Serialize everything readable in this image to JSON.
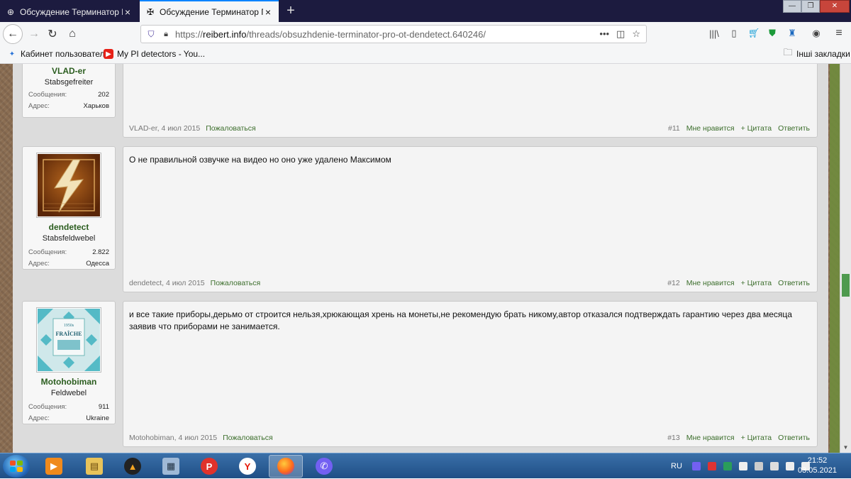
{
  "browser": {
    "tabs": [
      {
        "title": "Обсуждение Терминатор ПРО",
        "active": false
      },
      {
        "title": "Обсуждение Терминатор ПРО",
        "active": true
      }
    ],
    "url_prefix": "https://",
    "url_domain": "reibert.info",
    "url_path": "/threads/obsuzhdenie-terminator-pro-ot-dendetect.640246/",
    "bookmarks": [
      {
        "label": "Кабинет пользователя"
      },
      {
        "label": "My PI detectors - You..."
      }
    ],
    "other_bookmarks": "Інші закладки"
  },
  "posts": [
    {
      "username": "VLAD-er",
      "rank": "Stabsgefreiter",
      "messages_label": "Сообщения:",
      "messages": "202",
      "address_label": "Адрес:",
      "address": "Харьков",
      "text": "",
      "meta": "VLAD-er, 4 июл 2015",
      "report": "Пожаловаться",
      "number": "#11",
      "like": "Мне нравится",
      "quote": "+ Цитата",
      "reply": "Ответить"
    },
    {
      "username": "dendetect",
      "rank": "Stabsfeldwebel",
      "messages_label": "Сообщения:",
      "messages": "2.822",
      "address_label": "Адрес:",
      "address": "Одесса",
      "text": "О не правильной озвучке на видео но оно уже удалено Максимом",
      "meta": "dendetect, 4 июл 2015",
      "report": "Пожаловаться",
      "number": "#12",
      "like": "Мне нравится",
      "quote": "+ Цитата",
      "reply": "Ответить"
    },
    {
      "username": "Motohobiman",
      "rank": "Feldwebel",
      "messages_label": "Сообщения:",
      "messages": "911",
      "address_label": "Адрес:",
      "address": "Ukraine",
      "text": "и все такие приборы,дерьмо от строится нельзя,хрюкающая хрень на монеты,не рекомендую брать никому,автор отказался подтверждать гарантию через два месяца заявив что приборами не занимается.",
      "meta": "Motohobiman, 4 июл 2015",
      "report": "Пожаловаться",
      "number": "#13",
      "like": "Мне нравится",
      "quote": "+ Цитата",
      "reply": "Ответить"
    }
  ],
  "avatar_text": {
    "top": "1950s",
    "main": "FRAÎCHE"
  },
  "taskbar": {
    "lang": "RU",
    "time": "21:52",
    "date": "03.05.2021",
    "colors": {
      "accent": "#0a84ff",
      "link_green": "#3c6e2c",
      "username_green": "#2b5d1f"
    }
  }
}
